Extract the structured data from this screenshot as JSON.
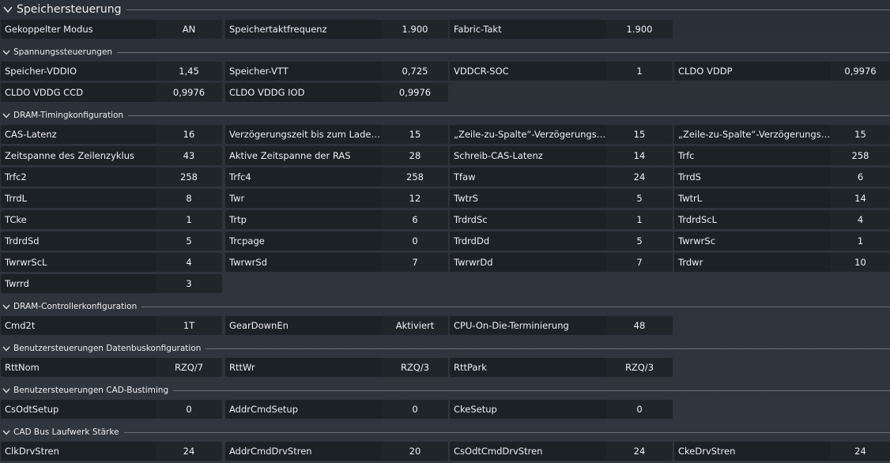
{
  "title": "Speichersteuerung",
  "sections": {
    "top": {
      "cells": [
        {
          "label": "Gekoppelter Modus",
          "value": "AN"
        },
        {
          "label": "Speichertaktfrequenz",
          "value": "1.900"
        },
        {
          "label": "Fabric-Takt",
          "value": "1.900"
        }
      ]
    },
    "voltage": {
      "title": "Spannungssteuerungen",
      "cells": [
        {
          "label": "Speicher-VDDIO",
          "value": "1,45"
        },
        {
          "label": "Speicher-VTT",
          "value": "0,725"
        },
        {
          "label": "VDDCR-SOC",
          "value": "1"
        },
        {
          "label": "CLDO VDDP",
          "value": "0,9976"
        },
        {
          "label": "CLDO VDDG CCD",
          "value": "0,9976"
        },
        {
          "label": "CLDO VDDG IOD",
          "value": "0,9976"
        }
      ]
    },
    "timing": {
      "title": "DRAM-Timingkonfiguration",
      "cells": [
        {
          "label": "CAS-Latenz",
          "value": "16"
        },
        {
          "label": "Verzögerungszeit bis zum Laden der ...",
          "value": "15"
        },
        {
          "label": "„Zeile-zu-Spalte“-Verzögerungszeit f...",
          "value": "15"
        },
        {
          "label": "„Zeile-zu-Spalte“-Verzögerungszeit f...",
          "value": "15"
        },
        {
          "label": "Zeitspanne des Zeilenzyklus",
          "value": "43"
        },
        {
          "label": "Aktive Zeitspanne der RAS",
          "value": "28"
        },
        {
          "label": "Schreib-CAS-Latenz",
          "value": "14"
        },
        {
          "label": "Trfc",
          "value": "258"
        },
        {
          "label": "Trfc2",
          "value": "258"
        },
        {
          "label": "Trfc4",
          "value": "258"
        },
        {
          "label": "Tfaw",
          "value": "24"
        },
        {
          "label": "TrrdS",
          "value": "6"
        },
        {
          "label": "TrrdL",
          "value": "8"
        },
        {
          "label": "Twr",
          "value": "12"
        },
        {
          "label": "TwtrS",
          "value": "5"
        },
        {
          "label": "TwtrL",
          "value": "14"
        },
        {
          "label": "TCke",
          "value": "1"
        },
        {
          "label": "Trtp",
          "value": "6"
        },
        {
          "label": "TrdrdSc",
          "value": "1"
        },
        {
          "label": "TrdrdScL",
          "value": "4"
        },
        {
          "label": "TrdrdSd",
          "value": "5"
        },
        {
          "label": "Trcpage",
          "value": "0"
        },
        {
          "label": "TrdrdDd",
          "value": "5"
        },
        {
          "label": "TwrwrSc",
          "value": "1"
        },
        {
          "label": "TwrwrScL",
          "value": "4"
        },
        {
          "label": "TwrwrSd",
          "value": "7"
        },
        {
          "label": "TwrwrDd",
          "value": "7"
        },
        {
          "label": "Trdwr",
          "value": "10"
        },
        {
          "label": "Twrrd",
          "value": "3"
        }
      ]
    },
    "controller": {
      "title": "DRAM-Controllerkonfiguration",
      "cells": [
        {
          "label": "Cmd2t",
          "value": "1T"
        },
        {
          "label": "GearDownEn",
          "value": "Aktiviert"
        },
        {
          "label": "CPU-On-Die-Terminierung",
          "value": "48"
        }
      ]
    },
    "databus": {
      "title": "Benutzersteuerungen Datenbuskonfiguration",
      "cells": [
        {
          "label": "RttNom",
          "value": "RZQ/7"
        },
        {
          "label": "RttWr",
          "value": "RZQ/3"
        },
        {
          "label": "RttPark",
          "value": "RZQ/3"
        }
      ]
    },
    "cad": {
      "title": "Benutzersteuerungen CAD-Bustiming",
      "cells": [
        {
          "label": "CsOdtSetup",
          "value": "0"
        },
        {
          "label": "AddrCmdSetup",
          "value": "0"
        },
        {
          "label": "CkeSetup",
          "value": "0"
        }
      ]
    },
    "drive": {
      "title": "CAD Bus Laufwerk Stärke",
      "cells": [
        {
          "label": "ClkDrvStren",
          "value": "24"
        },
        {
          "label": "AddrCmdDrvStren",
          "value": "20"
        },
        {
          "label": "CsOdtCmdDrvStren",
          "value": "24"
        },
        {
          "label": "CkeDrvStren",
          "value": "24"
        }
      ]
    }
  }
}
